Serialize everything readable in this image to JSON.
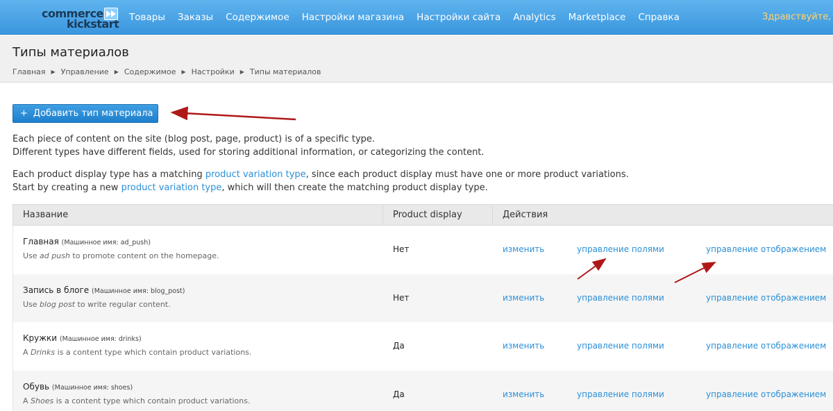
{
  "logo": {
    "line1": "commerce",
    "line2": "kickstart",
    "badge_icon": "fast-forward-icon"
  },
  "nav": [
    "Товары",
    "Заказы",
    "Содержимое",
    "Настройки магазина",
    "Настройки сайта",
    "Analytics",
    "Marketplace",
    "Справка"
  ],
  "greeting": "Здравствуйте, a",
  "page": {
    "title": "Типы материалов",
    "breadcrumb": [
      "Главная",
      "Управление",
      "Содержимое",
      "Настройки",
      "Типы материалов"
    ]
  },
  "add_button": {
    "icon": "+",
    "label": "Добавить тип материала"
  },
  "intro": {
    "p1_line1": "Each piece of content on the site (blog post, page, product) is of a specific type.",
    "p1_line2": "Different types have different fields, used for storing additional information, or categorizing the content.",
    "p2_line1_a": "Each product display type has a matching ",
    "p2_line1_link": "product variation type",
    "p2_line1_b": ", since each product display must have one or more product variations.",
    "p2_line2_a": "Start by creating a new ",
    "p2_line2_link": "product variation type",
    "p2_line2_b": ", which will then create the matching product display type."
  },
  "table": {
    "headers": {
      "name": "Название",
      "display": "Product display",
      "actions": "Действия"
    },
    "rows": [
      {
        "name": "Главная",
        "machine": "(Машинное имя: ad_push)",
        "desc_a": "Use ",
        "desc_em": "ad push",
        "desc_b": " to promote content on the homepage.",
        "display": "Нет",
        "edit": "изменить",
        "fields": "управление полями",
        "view": "управление отображением"
      },
      {
        "name": "Запись в блоге",
        "machine": "(Машинное имя: blog_post)",
        "desc_a": "Use ",
        "desc_em": "blog post",
        "desc_b": " to write regular content.",
        "display": "Нет",
        "edit": "изменить",
        "fields": "управление полями",
        "view": "управление отображением"
      },
      {
        "name": "Кружки",
        "machine": "(Машинное имя: drinks)",
        "desc_a": "A ",
        "desc_em": "Drinks",
        "desc_b": " is a content type which contain product variations.",
        "display": "Да",
        "edit": "изменить",
        "fields": "управление полями",
        "view": "управление отображением"
      },
      {
        "name": "Обувь",
        "machine": "(Машинное имя: shoes)",
        "desc_a": "A ",
        "desc_em": "Shoes",
        "desc_b": " is a content type which contain product variations.",
        "display": "Да",
        "edit": "изменить",
        "fields": "управление полями",
        "view": "управление отображением"
      }
    ]
  },
  "colors": {
    "nav_bg": "#3a96de",
    "link": "#2b8fd6",
    "annotation_arrow": "#b01818",
    "greeting": "#ffd470"
  }
}
